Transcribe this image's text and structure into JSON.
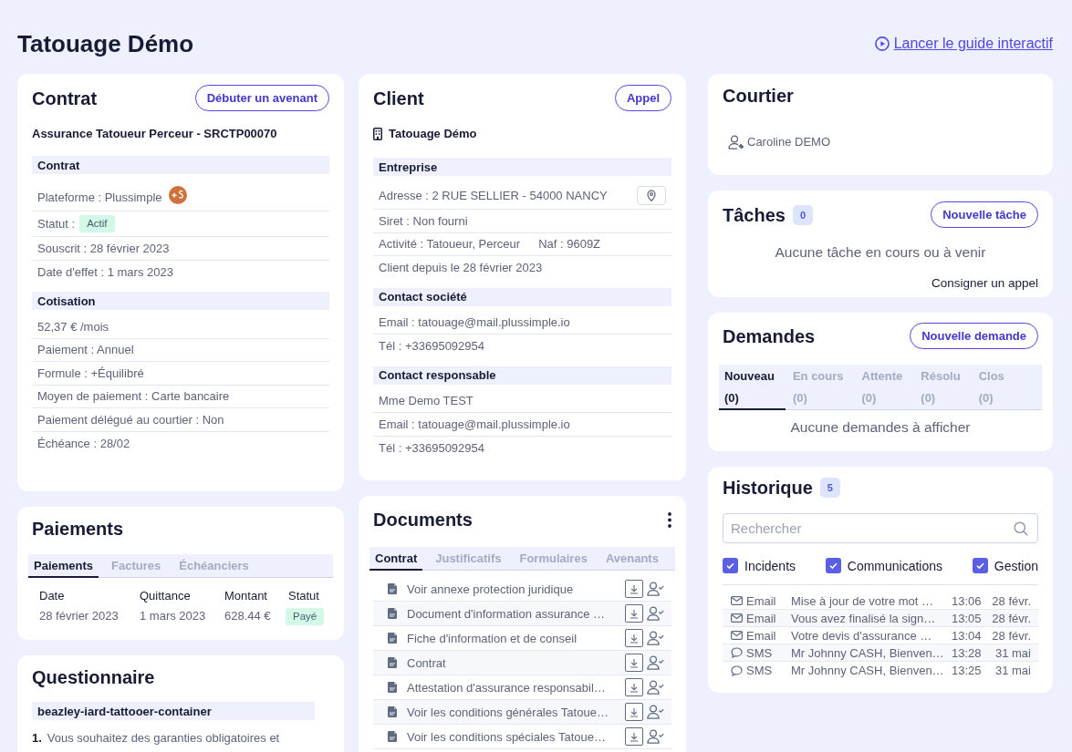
{
  "header": {
    "title": "Tatouage Démo",
    "guide_link": "Lancer le guide interactif"
  },
  "contract": {
    "title": "Contrat",
    "button": "Débuter un avenant",
    "product": "Assurance Tatoueur Perceur - SRCTP00070",
    "sections": [
      {
        "title": "Contrat",
        "rows": [
          {
            "kind": "platform",
            "text": "Plateforme : Plussimple"
          },
          {
            "kind": "status",
            "text": "Statut :",
            "badge": "Actif"
          },
          {
            "kind": "text",
            "text": "Souscrit : 28 février 2023"
          },
          {
            "kind": "text",
            "text": "Date d'effet : 1 mars 2023"
          }
        ]
      },
      {
        "title": "Cotisation",
        "rows": [
          {
            "kind": "text",
            "text": "52,37 € /mois"
          },
          {
            "kind": "text",
            "text": "Paiement : Annuel"
          },
          {
            "kind": "text",
            "text": "Formule : +Équilibré"
          },
          {
            "kind": "text",
            "text": "Moyen de paiement : Carte bancaire"
          },
          {
            "kind": "text",
            "text": "Paiement délégué au courtier : Non"
          },
          {
            "kind": "text",
            "text": "Échéance : 28/02"
          }
        ]
      }
    ]
  },
  "payments": {
    "title": "Paiements",
    "tabs": [
      {
        "label": "Paiements",
        "selected": true
      },
      {
        "label": "Factures",
        "selected": false
      },
      {
        "label": "Échéanciers",
        "selected": false
      }
    ],
    "columns": [
      "Date",
      "Quittance",
      "Montant",
      "Statut"
    ],
    "rows": [
      {
        "date": "28 février 2023",
        "receipt": "1 mars 2023",
        "amount": "628.44 €",
        "status": "Payé"
      }
    ]
  },
  "questionnaire": {
    "title": "Questionnaire",
    "section": "beazley-iard-tattooer-container",
    "questions": [
      {
        "number": "1.",
        "text": "Vous souhaitez des garanties obligatoires et"
      }
    ]
  },
  "client": {
    "title": "Client",
    "button": "Appel",
    "name": "Tatouage Démo",
    "sections": [
      {
        "title": "Entreprise",
        "rows": [
          {
            "kind": "address",
            "text": "Adresse : 2 RUE SELLIER - 54000 NANCY"
          },
          {
            "kind": "text",
            "text": "Siret : Non fourni"
          },
          {
            "kind": "activity",
            "text": "Activité : Tatoueur, Perceur",
            "extra": "Naf : 9609Z"
          },
          {
            "kind": "text",
            "text": "Client depuis le 28 février 2023"
          }
        ]
      },
      {
        "title": "Contact société",
        "rows": [
          {
            "kind": "text",
            "text": "Email : tatouage@mail.plussimple.io"
          },
          {
            "kind": "text",
            "text": "Tél : +33695092954"
          }
        ]
      },
      {
        "title": "Contact responsable",
        "rows": [
          {
            "kind": "text",
            "text": "Mme Demo TEST"
          },
          {
            "kind": "text",
            "text": "Email : tatouage@mail.plussimple.io"
          },
          {
            "kind": "text",
            "text": "Tél : +33695092954"
          }
        ]
      }
    ]
  },
  "documents": {
    "title": "Documents",
    "tabs": [
      {
        "label": "Contrat",
        "selected": true
      },
      {
        "label": "Justificatifs",
        "selected": false
      },
      {
        "label": "Formulaires",
        "selected": false
      },
      {
        "label": "Avenants",
        "selected": false
      }
    ],
    "files": [
      "Voir annexe protection juridique",
      "Document d'information assurance …",
      "Fiche d'information et de conseil",
      "Contrat",
      "Attestation d'assurance responsabil…",
      "Voir les conditions générales Tatoue…",
      "Voir les conditions spéciales Tatoue…"
    ]
  },
  "broker": {
    "title": "Courtier",
    "name": "Caroline DEMO"
  },
  "tasks": {
    "title": "Tâches",
    "count": "0",
    "button": "Nouvelle tâche",
    "empty": "Aucune tâche en cours ou à venir",
    "link": "Consigner un appel"
  },
  "requests": {
    "title": "Demandes",
    "button": "Nouvelle demande",
    "tabs": [
      {
        "label": "Nouveau",
        "count": "(0)",
        "selected": true
      },
      {
        "label": "En cours",
        "count": "(0)",
        "selected": false
      },
      {
        "label": "Attente",
        "count": "(0)",
        "selected": false
      },
      {
        "label": "Résolu",
        "count": "(0)",
        "selected": false
      },
      {
        "label": "Clos",
        "count": "(0)",
        "selected": false
      }
    ],
    "empty": "Aucune demandes à afficher"
  },
  "history": {
    "title": "Historique",
    "count": "5",
    "search": {
      "placeholder": "Rechercher"
    },
    "filters": [
      {
        "label": "Incidents",
        "checked": true
      },
      {
        "label": "Communications",
        "checked": true
      },
      {
        "label": "Gestion",
        "checked": true
      }
    ],
    "rows": [
      {
        "kind": "email",
        "type": "Email",
        "subject": "Mise à jour de votre mot …",
        "time": "13:06",
        "date": "28 févr."
      },
      {
        "kind": "email",
        "type": "Email",
        "subject": "Vous avez finalisé la sign…",
        "time": "13:05",
        "date": "28 févr."
      },
      {
        "kind": "email",
        "type": "Email",
        "subject": "Votre devis d'assurance …",
        "time": "13:04",
        "date": "28 févr."
      },
      {
        "kind": "sms",
        "type": "SMS",
        "subject": "Mr Johnny CASH, Bienven…",
        "time": "13:28",
        "date": "31 mai"
      },
      {
        "kind": "sms",
        "type": "SMS",
        "subject": "Mr Johnny CASH, Bienven…",
        "time": "13:25",
        "date": "31 mai"
      }
    ]
  }
}
